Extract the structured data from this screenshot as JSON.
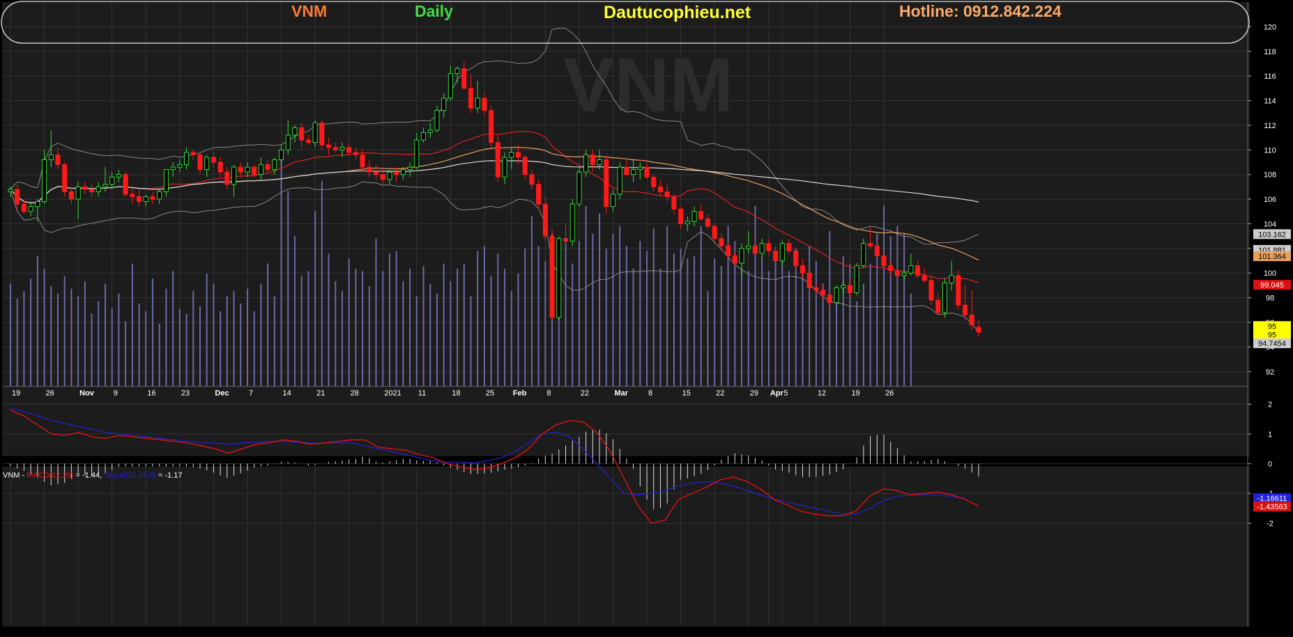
{
  "header": {
    "ticker": "VNM",
    "period": "Daily",
    "site": "Dautucophieu.net",
    "hotline": "Hotline: 0912.842.224",
    "watermark": "VNM"
  },
  "colors": {
    "background": "#000000",
    "panel": "#1c1c1c",
    "up": "#33dd33",
    "down": "#ff1a1a",
    "ticker": "#ff7a33",
    "period": "#44dd44",
    "site": "#ffff33",
    "hotline": "#ffaa66",
    "ma_red": "#dd2222",
    "ma_orange": "#e8a060",
    "ma_white": "#d8d8d8",
    "bollinger": "#888888",
    "volume": "#6a6aa8",
    "macd_line": "#ee1111",
    "signal_line": "#2222cc",
    "hist": "#e0e0e0"
  },
  "price_panel": {
    "y_ticks": [
      92,
      94,
      96,
      98,
      100,
      102,
      104,
      106,
      108,
      110,
      112,
      114,
      116,
      118,
      120
    ],
    "y_tick_labels": [
      "92",
      "94",
      "96",
      "98",
      "100",
      "102",
      "104",
      "106",
      "108",
      "110",
      "112",
      "114",
      "116",
      "118",
      "120"
    ],
    "x_labels": [
      "19",
      "26",
      "Nov",
      "9",
      "16",
      "23",
      "Dec",
      "7",
      "14",
      "21",
      "28",
      "2021",
      "11",
      "18",
      "25",
      "Feb",
      "8",
      "22",
      "Mar",
      "8",
      "15",
      "22",
      "29",
      "Apr",
      "5",
      "12",
      "19",
      "26"
    ],
    "x_label_index": [
      0,
      5,
      10,
      15,
      20,
      25,
      30,
      35,
      40,
      45,
      50,
      55,
      60,
      65,
      70,
      74,
      79,
      84,
      89,
      94,
      99,
      104,
      109,
      112,
      114,
      119,
      124,
      129
    ],
    "value_tags": [
      {
        "label": "103.162",
        "value": 103.162,
        "bg": "#cccccc",
        "fg": "#000000"
      },
      {
        "label": "101.881",
        "value": 101.881,
        "bg": "#cccccc",
        "fg": "#000000"
      },
      {
        "label": "101.364",
        "value": 101.364,
        "bg": "#e8a060",
        "fg": "#000000"
      },
      {
        "label": "99.045",
        "value": 99.045,
        "bg": "#dd1111",
        "fg": "#ffffff"
      },
      {
        "label": "95",
        "value": 95.7,
        "bg": "#ffff00",
        "fg": "#000000"
      },
      {
        "label": "95",
        "value": 95.0,
        "bg": "#ffff00",
        "fg": "#000000"
      },
      {
        "label": "94.7454",
        "value": 94.3,
        "bg": "#cccccc",
        "fg": "#000000"
      }
    ]
  },
  "macd_panel": {
    "legend_parts": [
      {
        "text": "VNM - ",
        "color": "#ffffff"
      },
      {
        "text": "MACD(12,26)",
        "color": "#ee1111"
      },
      {
        "text": " = -1.44, ",
        "color": "#ffffff"
      },
      {
        "text": "Signal(12,26,9)",
        "color": "#2222cc"
      },
      {
        "text": " = -1.17",
        "color": "#ffffff"
      }
    ],
    "y_ticks": [
      2,
      1,
      0,
      -1,
      -2
    ],
    "y_tick_labels": [
      "2",
      "1",
      "0",
      "-1",
      "-2"
    ],
    "value_tags": [
      {
        "label": "-1.16611",
        "value": -1.16,
        "bg": "#2222dd",
        "fg": "#ffffff"
      },
      {
        "label": "-1.43563",
        "value": -1.44,
        "bg": "#dd1111",
        "fg": "#ffffff"
      }
    ]
  },
  "chart_data": {
    "type": "candlestick",
    "title": "VNM Daily",
    "ylim": [
      90.8,
      122
    ],
    "macd_ylim": [
      -2.2,
      2.2
    ],
    "ohlc": [
      [
        106.6,
        107.0,
        106.2,
        106.8
      ],
      [
        106.8,
        107.2,
        105.0,
        105.6
      ],
      [
        105.6,
        106.0,
        104.8,
        105.0
      ],
      [
        105.0,
        105.8,
        104.6,
        105.4
      ],
      [
        105.4,
        106.0,
        104.2,
        105.8
      ],
      [
        105.8,
        110.0,
        105.6,
        109.2
      ],
      [
        109.2,
        111.6,
        108.6,
        109.6
      ],
      [
        109.6,
        110.2,
        108.4,
        108.8
      ],
      [
        108.8,
        109.0,
        106.2,
        106.6
      ],
      [
        106.6,
        107.0,
        105.6,
        106.0
      ],
      [
        106.0,
        107.4,
        104.4,
        107.0
      ],
      [
        107.0,
        107.4,
        106.4,
        106.8
      ],
      [
        106.8,
        107.2,
        106.2,
        106.6
      ],
      [
        106.6,
        107.4,
        106.2,
        107.0
      ],
      [
        107.0,
        108.6,
        106.6,
        107.2
      ],
      [
        107.2,
        108.2,
        106.8,
        107.8
      ],
      [
        107.8,
        108.4,
        107.4,
        108.0
      ],
      [
        108.0,
        108.2,
        106.2,
        106.4
      ],
      [
        106.4,
        106.8,
        105.6,
        106.2
      ],
      [
        106.2,
        106.8,
        105.4,
        105.8
      ],
      [
        105.8,
        106.4,
        105.4,
        106.2
      ],
      [
        106.2,
        106.6,
        105.6,
        106.0
      ],
      [
        106.0,
        106.8,
        105.6,
        106.6
      ],
      [
        106.6,
        107.4,
        106.2,
        108.4
      ],
      [
        108.4,
        109.0,
        107.8,
        108.6
      ],
      [
        108.6,
        109.2,
        108.2,
        108.8
      ],
      [
        108.8,
        110.2,
        108.4,
        109.8
      ],
      [
        109.8,
        110.0,
        109.2,
        109.6
      ],
      [
        109.6,
        109.8,
        108.0,
        108.4
      ],
      [
        108.4,
        109.6,
        107.8,
        109.4
      ],
      [
        109.4,
        109.8,
        108.6,
        109.0
      ],
      [
        109.0,
        109.4,
        107.8,
        108.2
      ],
      [
        108.2,
        108.6,
        106.8,
        107.2
      ],
      [
        107.2,
        108.8,
        106.2,
        108.6
      ],
      [
        108.6,
        109.0,
        107.8,
        108.2
      ],
      [
        108.2,
        109.0,
        107.8,
        108.6
      ],
      [
        108.6,
        108.8,
        107.8,
        108.0
      ],
      [
        108.0,
        109.4,
        107.6,
        108.8
      ],
      [
        108.8,
        109.2,
        108.2,
        108.4
      ],
      [
        108.4,
        109.4,
        108.0,
        109.2
      ],
      [
        109.2,
        110.4,
        108.8,
        110.0
      ],
      [
        110.0,
        112.4,
        109.6,
        111.2
      ],
      [
        111.2,
        112.0,
        110.6,
        111.8
      ],
      [
        111.8,
        112.2,
        110.2,
        110.8
      ],
      [
        110.8,
        111.2,
        110.4,
        110.6
      ],
      [
        110.6,
        112.4,
        110.2,
        112.2
      ],
      [
        112.2,
        112.4,
        110.0,
        110.4
      ],
      [
        110.4,
        111.0,
        109.6,
        110.2
      ],
      [
        110.2,
        110.6,
        109.8,
        110.0
      ],
      [
        110.0,
        110.6,
        109.4,
        110.2
      ],
      [
        110.2,
        110.6,
        109.6,
        109.8
      ],
      [
        109.8,
        110.2,
        109.2,
        109.6
      ],
      [
        109.6,
        110.0,
        108.2,
        108.6
      ],
      [
        108.6,
        109.2,
        107.8,
        108.2
      ],
      [
        108.2,
        108.8,
        107.6,
        108.0
      ],
      [
        108.0,
        108.6,
        107.2,
        107.6
      ],
      [
        107.6,
        108.4,
        107.2,
        108.2
      ],
      [
        108.2,
        108.6,
        107.4,
        108.0
      ],
      [
        108.0,
        108.6,
        107.6,
        108.4
      ],
      [
        108.4,
        109.0,
        107.8,
        108.6
      ],
      [
        108.6,
        111.4,
        108.4,
        110.8
      ],
      [
        110.8,
        111.8,
        110.6,
        111.4
      ],
      [
        111.4,
        112.2,
        111.0,
        111.6
      ],
      [
        111.6,
        113.6,
        111.4,
        113.2
      ],
      [
        113.2,
        114.6,
        112.6,
        114.2
      ],
      [
        114.2,
        116.8,
        114.0,
        116.2
      ],
      [
        116.2,
        116.8,
        115.4,
        116.6
      ],
      [
        116.6,
        117.2,
        115.6,
        115.0
      ],
      [
        115.0,
        116.2,
        113.0,
        113.4
      ],
      [
        113.4,
        115.6,
        113.0,
        114.2
      ],
      [
        114.2,
        114.6,
        112.8,
        113.2
      ],
      [
        113.2,
        113.6,
        110.2,
        110.6
      ],
      [
        110.6,
        111.2,
        107.4,
        107.8
      ],
      [
        107.8,
        109.8,
        107.2,
        109.4
      ],
      [
        109.4,
        110.2,
        108.4,
        109.8
      ],
      [
        109.8,
        110.4,
        108.8,
        109.4
      ],
      [
        109.4,
        109.6,
        107.6,
        108.0
      ],
      [
        108.0,
        108.4,
        106.8,
        107.2
      ],
      [
        107.2,
        107.6,
        105.2,
        105.6
      ],
      [
        105.6,
        106.2,
        102.6,
        103.0
      ],
      [
        103.0,
        103.6,
        96.2,
        96.4
      ],
      [
        96.4,
        103.0,
        96.2,
        102.8
      ],
      [
        102.8,
        104.0,
        102.0,
        102.6
      ],
      [
        102.6,
        106.0,
        102.2,
        105.6
      ],
      [
        105.6,
        108.6,
        105.4,
        108.2
      ],
      [
        108.2,
        110.0,
        107.8,
        109.6
      ],
      [
        109.6,
        110.0,
        108.2,
        108.8
      ],
      [
        108.8,
        110.0,
        108.4,
        109.2
      ],
      [
        109.2,
        109.6,
        104.8,
        105.4
      ],
      [
        105.4,
        106.8,
        105.0,
        106.4
      ],
      [
        106.4,
        109.0,
        106.0,
        108.6
      ],
      [
        108.6,
        109.2,
        107.8,
        108.0
      ],
      [
        108.0,
        109.2,
        107.4,
        108.4
      ],
      [
        108.4,
        109.0,
        107.6,
        108.6
      ],
      [
        108.6,
        109.0,
        107.6,
        107.8
      ],
      [
        107.8,
        108.0,
        106.6,
        107.0
      ],
      [
        107.0,
        107.6,
        106.2,
        106.6
      ],
      [
        106.6,
        107.2,
        105.8,
        106.2
      ],
      [
        106.2,
        106.4,
        104.8,
        105.2
      ],
      [
        105.2,
        105.4,
        103.6,
        104.0
      ],
      [
        104.0,
        104.6,
        103.4,
        104.2
      ],
      [
        104.2,
        105.4,
        103.8,
        105.0
      ],
      [
        105.0,
        105.6,
        104.2,
        104.4
      ],
      [
        104.4,
        104.8,
        103.6,
        103.8
      ],
      [
        103.8,
        104.0,
        102.6,
        102.8
      ],
      [
        102.8,
        103.2,
        101.8,
        102.2
      ],
      [
        102.2,
        102.6,
        101.2,
        101.4
      ],
      [
        101.4,
        101.8,
        100.6,
        100.8
      ],
      [
        100.8,
        102.4,
        99.8,
        102.0
      ],
      [
        102.0,
        103.4,
        101.6,
        102.2
      ],
      [
        102.2,
        103.0,
        101.4,
        101.6
      ],
      [
        101.6,
        102.8,
        101.2,
        102.4
      ],
      [
        102.4,
        102.8,
        101.4,
        101.8
      ],
      [
        101.8,
        102.2,
        100.8,
        101.0
      ],
      [
        101.0,
        102.6,
        100.6,
        102.4
      ],
      [
        102.4,
        102.8,
        101.6,
        101.8
      ],
      [
        101.8,
        102.0,
        100.2,
        100.6
      ],
      [
        100.6,
        101.2,
        99.6,
        100.0
      ],
      [
        100.0,
        100.4,
        98.4,
        98.8
      ],
      [
        98.8,
        99.2,
        98.2,
        98.6
      ],
      [
        98.6,
        99.0,
        97.8,
        98.2
      ],
      [
        98.2,
        98.6,
        97.2,
        97.6
      ],
      [
        97.6,
        99.0,
        97.4,
        98.8
      ],
      [
        98.8,
        99.4,
        98.2,
        99.0
      ],
      [
        99.0,
        99.6,
        98.0,
        98.4
      ],
      [
        98.4,
        100.8,
        98.2,
        100.6
      ],
      [
        100.6,
        102.8,
        100.4,
        102.4
      ],
      [
        102.4,
        103.8,
        102.0,
        102.2
      ],
      [
        102.2,
        102.6,
        101.2,
        101.4
      ],
      [
        101.4,
        101.6,
        100.4,
        100.6
      ],
      [
        100.6,
        101.0,
        99.8,
        100.2
      ],
      [
        100.2,
        100.6,
        99.6,
        99.8
      ],
      [
        99.8,
        100.2,
        99.4,
        100.0
      ],
      [
        100.0,
        101.6,
        99.8,
        100.6
      ],
      [
        100.6,
        101.0,
        99.6,
        99.8
      ],
      [
        99.8,
        100.4,
        99.2,
        99.4
      ],
      [
        99.4,
        99.8,
        97.4,
        97.8
      ],
      [
        97.8,
        98.4,
        96.6,
        96.8
      ],
      [
        96.8,
        99.6,
        96.4,
        99.2
      ],
      [
        99.2,
        101.0,
        98.6,
        99.8
      ],
      [
        99.8,
        100.2,
        97.0,
        97.4
      ],
      [
        97.4,
        99.0,
        96.2,
        96.6
      ],
      [
        96.6,
        98.6,
        95.4,
        95.8
      ],
      [
        95.6,
        96.2,
        94.8,
        95.2
      ]
    ],
    "volume": [
      0.41,
      0.35,
      0.38,
      0.43,
      0.52,
      0.47,
      0.4,
      0.37,
      0.44,
      0.39,
      0.36,
      0.42,
      0.29,
      0.34,
      0.41,
      0.31,
      0.37,
      0.26,
      0.49,
      0.33,
      0.3,
      0.43,
      0.25,
      0.39,
      0.46,
      0.31,
      0.29,
      0.38,
      0.32,
      0.45,
      0.41,
      0.3,
      0.36,
      0.38,
      0.33,
      0.39,
      0.3,
      0.41,
      0.49,
      0.36,
      0.92,
      0.78,
      0.6,
      0.44,
      0.46,
      0.7,
      0.82,
      0.53,
      0.42,
      0.38,
      0.51,
      0.47,
      0.46,
      0.4,
      0.59,
      0.46,
      0.53,
      0.54,
      0.42,
      0.47,
      0.36,
      0.48,
      0.41,
      0.37,
      0.49,
      0.42,
      0.47,
      0.49,
      0.36,
      0.54,
      0.56,
      0.44,
      0.53,
      0.47,
      0.38,
      0.45,
      0.55,
      0.68,
      0.56,
      0.5,
      0.61,
      0.54,
      0.58,
      0.49,
      0.58,
      0.72,
      0.61,
      0.69,
      0.55,
      0.61,
      0.64,
      0.56,
      0.47,
      0.58,
      0.54,
      0.63,
      0.47,
      0.64,
      0.53,
      0.55,
      0.51,
      0.52,
      0.64,
      0.38,
      0.51,
      0.48,
      0.64,
      0.58,
      0.47,
      0.46,
      0.72,
      0.52,
      0.46,
      0.53,
      0.5,
      0.46,
      0.55,
      0.46,
      0.56,
      0.5,
      0.41,
      0.62,
      0.38,
      0.52,
      0.49,
      0.34,
      0.41,
      0.49,
      0.61,
      0.72,
      0.6,
      0.64,
      0.61,
      0.37
    ],
    "series": [],
    "macd": [
      1.8,
      1.6,
      1.3,
      1.0,
      0.95,
      1.05,
      0.9,
      0.85,
      0.95,
      0.9,
      0.85,
      0.8,
      0.75,
      0.7,
      0.6,
      0.5,
      0.35,
      0.5,
      0.65,
      0.7,
      0.8,
      0.75,
      0.65,
      0.7,
      0.75,
      0.8,
      0.8,
      0.55,
      0.5,
      0.45,
      0.3,
      0.2,
      0.0,
      -0.1,
      -0.2,
      -0.15,
      0.0,
      0.2,
      0.5,
      1.0,
      1.3,
      1.45,
      1.4,
      1.05,
      0.4,
      -0.5,
      -1.4,
      -2.0,
      -1.9,
      -1.2,
      -1.0,
      -0.8,
      -0.55,
      -0.45,
      -0.6,
      -0.85,
      -1.2,
      -1.4,
      -1.6,
      -1.7,
      -1.75,
      -1.75,
      -1.6,
      -1.1,
      -0.85,
      -0.9,
      -1.05,
      -1.0,
      -0.95,
      -1.05,
      -1.2,
      -1.43
    ],
    "signal": [
      1.85,
      1.75,
      1.6,
      1.45,
      1.35,
      1.25,
      1.15,
      1.05,
      1.0,
      0.95,
      0.9,
      0.85,
      0.8,
      0.75,
      0.7,
      0.7,
      0.65,
      0.7,
      0.72,
      0.75,
      0.75,
      0.72,
      0.7,
      0.68,
      0.7,
      0.7,
      0.6,
      0.5,
      0.4,
      0.3,
      0.2,
      0.1,
      0.05,
      0.05,
      0.02,
      0.1,
      0.2,
      0.4,
      0.7,
      1.0,
      1.05,
      0.9,
      0.5,
      0.0,
      -0.5,
      -1.0,
      -1.05,
      -1.0,
      -0.9,
      -0.75,
      -0.65,
      -0.6,
      -0.65,
      -0.75,
      -0.9,
      -1.05,
      -1.2,
      -1.3,
      -1.4,
      -1.5,
      -1.6,
      -1.7,
      -1.7,
      -1.5,
      -1.25,
      -1.1,
      -1.05,
      -1.05,
      -1.05,
      -1.1,
      -1.16
    ]
  }
}
